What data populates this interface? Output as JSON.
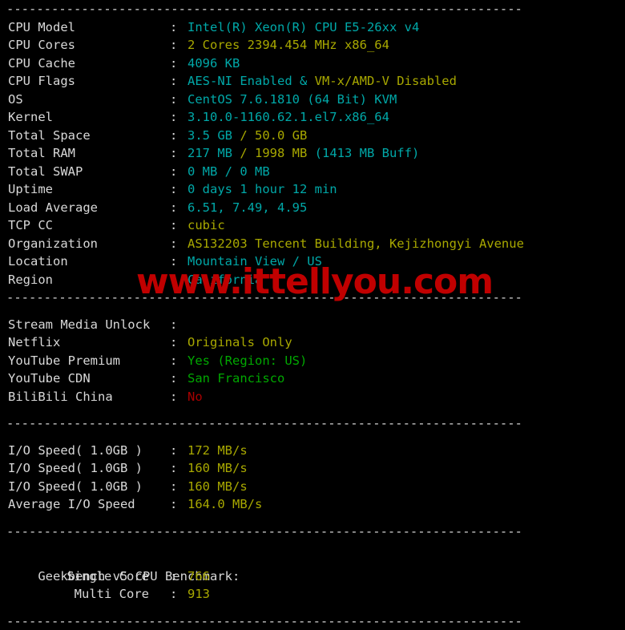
{
  "terminal": {
    "separator": "---------------------------------------------------------------------",
    "watermark": "www.ittellyou.com",
    "colon": ":",
    "colors": {
      "background": "#000000",
      "label": "#d8d8d8",
      "cyan": "#00a8a8",
      "yellow": "#a8a800",
      "green": "#00a800",
      "red": "#a80000",
      "watermark": "#c00000"
    }
  },
  "system_info": {
    "rows": [
      {
        "label": "CPU Model",
        "parts": [
          {
            "text": "Intel(R) Xeon(R) CPU E5-26xx v4",
            "color": "cy"
          }
        ]
      },
      {
        "label": "CPU Cores",
        "parts": [
          {
            "text": "2 Cores 2394.454 MHz x86_64",
            "color": "ye"
          }
        ]
      },
      {
        "label": "CPU Cache",
        "parts": [
          {
            "text": "4096 KB",
            "color": "cy"
          }
        ]
      },
      {
        "label": "CPU Flags",
        "parts": [
          {
            "text": "AES-NI Enabled & ",
            "color": "cy"
          },
          {
            "text": "VM-x/AMD-V Disabled",
            "color": "ye"
          }
        ]
      },
      {
        "label": "OS",
        "parts": [
          {
            "text": "CentOS 7.6.1810 (64 Bit) KVM",
            "color": "cy"
          }
        ]
      },
      {
        "label": "Kernel",
        "parts": [
          {
            "text": "3.10.0-1160.62.1.el7.x86_64",
            "color": "cy"
          }
        ]
      },
      {
        "label": "Total Space",
        "parts": [
          {
            "text": "3.5 GB ",
            "color": "cy"
          },
          {
            "text": "/ 50.0 GB",
            "color": "ye"
          }
        ]
      },
      {
        "label": "Total RAM",
        "parts": [
          {
            "text": "217 MB ",
            "color": "cy"
          },
          {
            "text": "/ 1998 MB ",
            "color": "ye"
          },
          {
            "text": "(1413 MB Buff)",
            "color": "cy"
          }
        ]
      },
      {
        "label": "Total SWAP",
        "parts": [
          {
            "text": "0 MB / 0 MB",
            "color": "cy"
          }
        ]
      },
      {
        "label": "Uptime",
        "parts": [
          {
            "text": "0 days 1 hour 12 min",
            "color": "cy"
          }
        ]
      },
      {
        "label": "Load Average",
        "parts": [
          {
            "text": "6.51, 7.49, 4.95",
            "color": "cy"
          }
        ]
      },
      {
        "label": "TCP CC",
        "parts": [
          {
            "text": "cubic",
            "color": "ye"
          }
        ]
      },
      {
        "label": "Organization",
        "parts": [
          {
            "text": "AS132203 Tencent Building, Kejizhongyi Avenue",
            "color": "ye"
          }
        ]
      },
      {
        "label": "Location",
        "parts": [
          {
            "text": "Mountain View / US",
            "color": "cy"
          }
        ]
      },
      {
        "label": "Region",
        "parts": [
          {
            "text": "California",
            "color": "cy"
          }
        ]
      }
    ]
  },
  "stream_media": {
    "rows": [
      {
        "label": "Stream Media Unlock",
        "parts": []
      },
      {
        "label": "Netflix",
        "parts": [
          {
            "text": "Originals Only",
            "color": "ye"
          }
        ]
      },
      {
        "label": "YouTube Premium",
        "parts": [
          {
            "text": "Yes (Region: US)",
            "color": "gr"
          }
        ]
      },
      {
        "label": "YouTube CDN",
        "parts": [
          {
            "text": "San Francisco",
            "color": "gr"
          }
        ]
      },
      {
        "label": "BiliBili China",
        "parts": [
          {
            "text": "No",
            "color": "rd"
          }
        ]
      }
    ]
  },
  "io_speed": {
    "rows": [
      {
        "label": "I/O Speed( 1.0GB )",
        "parts": [
          {
            "text": "172 MB/s",
            "color": "ye"
          }
        ]
      },
      {
        "label": "I/O Speed( 1.0GB )",
        "parts": [
          {
            "text": "160 MB/s",
            "color": "ye"
          }
        ]
      },
      {
        "label": "I/O Speed( 1.0GB )",
        "parts": [
          {
            "text": "160 MB/s",
            "color": "ye"
          }
        ]
      },
      {
        "label": "Average I/O Speed",
        "parts": [
          {
            "text": "164.0 MB/s",
            "color": "ye"
          }
        ]
      }
    ]
  },
  "geekbench": {
    "heading": "Geekbench v5 CPU Benchmark:",
    "rows": [
      {
        "label": "Single Core",
        "indent": true,
        "parts": [
          {
            "text": "766",
            "color": "ye"
          }
        ]
      },
      {
        "label": "Multi Core",
        "indent": true,
        "parts": [
          {
            "text": "913",
            "color": "ye"
          }
        ]
      }
    ]
  }
}
